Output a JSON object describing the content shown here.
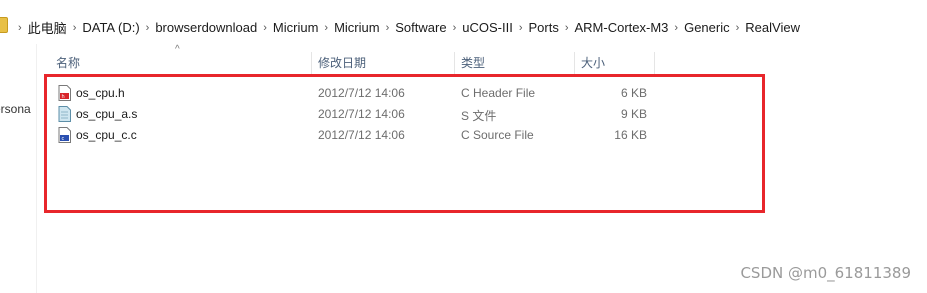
{
  "breadcrumb": [
    "此电脑",
    "DATA (D:)",
    "browserdownload",
    "Micrium",
    "Micrium",
    "Software",
    "uCOS-III",
    "Ports",
    "ARM-Cortex-M3",
    "Generic",
    "RealView"
  ],
  "nav": {
    "partial_item": "ersona"
  },
  "columns": {
    "name": "名称",
    "date": "修改日期",
    "type": "类型",
    "size": "大小"
  },
  "files": [
    {
      "name": "os_cpu.h",
      "date": "2012/7/12 14:06",
      "type": "C Header File",
      "size": "6 KB",
      "icon": "c-header-file-icon"
    },
    {
      "name": "os_cpu_a.s",
      "date": "2012/7/12 14:06",
      "type": "S 文件",
      "size": "9 KB",
      "icon": "s-file-icon"
    },
    {
      "name": "os_cpu_c.c",
      "date": "2012/7/12 14:06",
      "type": "C Source File",
      "size": "16 KB",
      "icon": "c-source-file-icon"
    }
  ],
  "colors": {
    "highlight_box": "#e8262b",
    "header_text": "#4c607a"
  },
  "watermark": "CSDN @m0_61811389"
}
